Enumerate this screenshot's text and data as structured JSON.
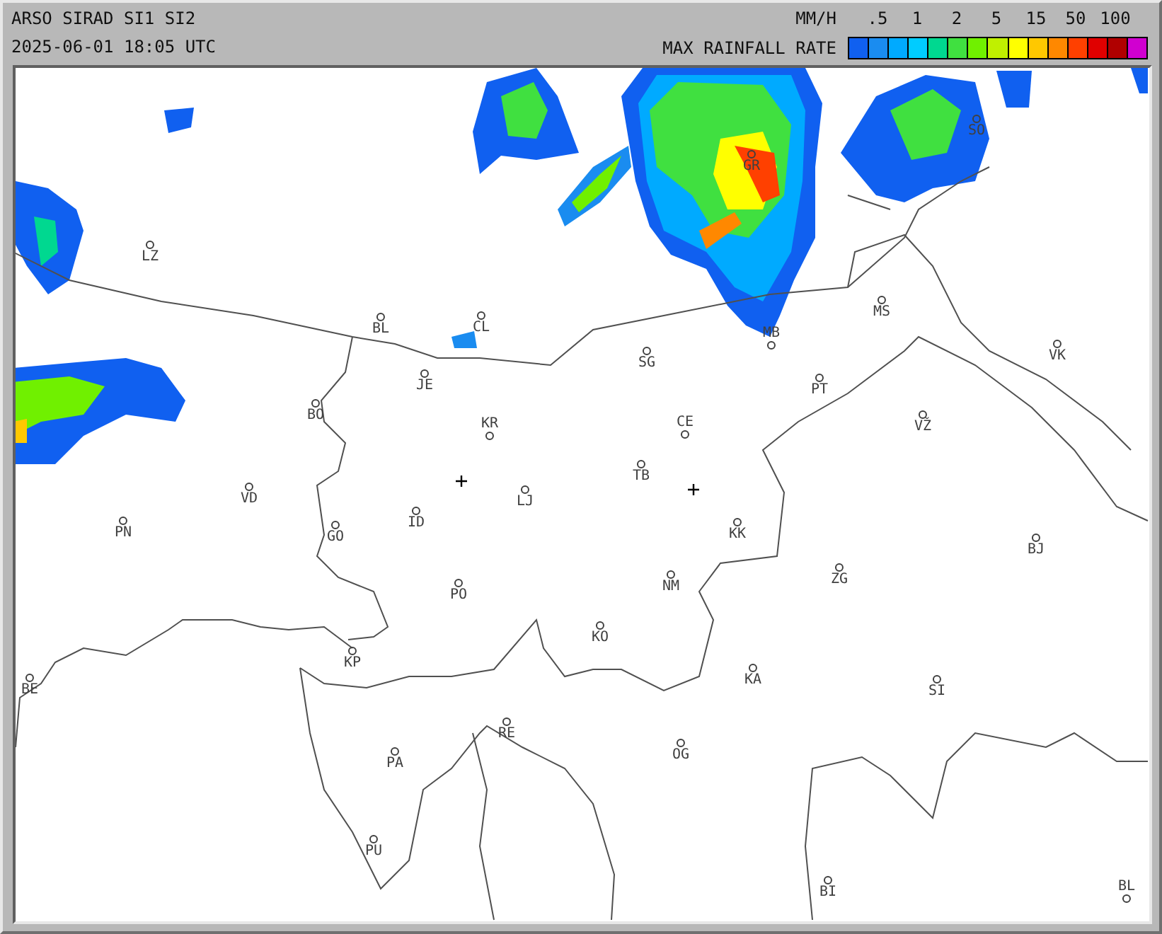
{
  "header": {
    "title": "ARSO SIRAD SI1 SI2",
    "timestamp": "2025-06-01 18:05 UTC"
  },
  "legend": {
    "unit": "MM/H",
    "ticks": [
      ".5",
      "1",
      "2",
      "5",
      "15",
      "50",
      "100"
    ],
    "title": "MAX RAINFALL RATE",
    "swatches": [
      {
        "color": "#1060f0"
      },
      {
        "color": "#1a8cf0"
      },
      {
        "color": "#00aaff"
      },
      {
        "color": "#00ccff"
      },
      {
        "color": "#00d890"
      },
      {
        "color": "#40e040"
      },
      {
        "color": "#70f000"
      },
      {
        "color": "#c0f000"
      },
      {
        "color": "#ffff00"
      },
      {
        "color": "#ffc800"
      },
      {
        "color": "#ff8800"
      },
      {
        "color": "#ff4000"
      },
      {
        "color": "#e00000"
      },
      {
        "color": "#b00000"
      },
      {
        "color": "#d000d0"
      }
    ]
  },
  "stations": [
    {
      "label": "LZ"
    },
    {
      "label": "BL"
    },
    {
      "label": "CL"
    },
    {
      "label": "JE"
    },
    {
      "label": "BO"
    },
    {
      "label": "KR"
    },
    {
      "label": "GR"
    },
    {
      "label": "SO"
    },
    {
      "label": "MS"
    },
    {
      "label": "MB"
    },
    {
      "label": "SG"
    },
    {
      "label": "PT"
    },
    {
      "label": "VK"
    },
    {
      "label": "CE"
    },
    {
      "label": "VŽ"
    },
    {
      "label": "TB"
    },
    {
      "label": "LJ"
    },
    {
      "label": "VD"
    },
    {
      "label": "PN"
    },
    {
      "label": "ID"
    },
    {
      "label": "GO"
    },
    {
      "label": "KK"
    },
    {
      "label": "BJ"
    },
    {
      "label": "ZG"
    },
    {
      "label": "NM"
    },
    {
      "label": "PO"
    },
    {
      "label": "KO"
    },
    {
      "label": "KP"
    },
    {
      "label": "KA"
    },
    {
      "label": "SI"
    },
    {
      "label": "BE"
    },
    {
      "label": "PA"
    },
    {
      "label": "RE"
    },
    {
      "label": "OG"
    },
    {
      "label": "PU"
    },
    {
      "label": "BI"
    },
    {
      "label": "BL"
    }
  ]
}
